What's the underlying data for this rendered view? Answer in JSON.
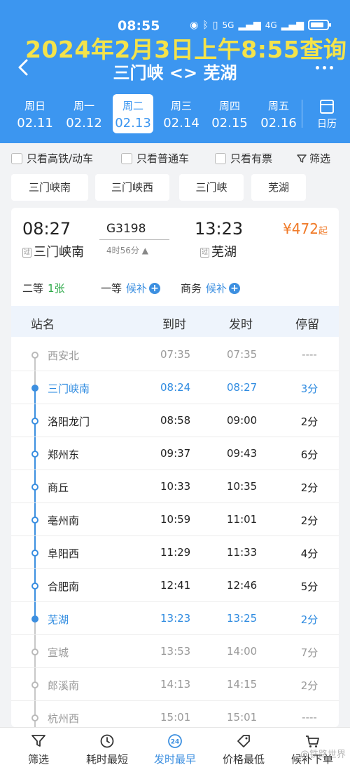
{
  "status": {
    "time": "08:55",
    "net1": "5G",
    "net2": "4G"
  },
  "overlay_text": "2024年2月3日上午8:55查询",
  "header": {
    "route_title": "三门峡 <> 芜湖"
  },
  "dates": [
    {
      "weekday": "周日",
      "date": "02.11"
    },
    {
      "weekday": "周一",
      "date": "02.12"
    },
    {
      "weekday": "周二",
      "date": "02.13"
    },
    {
      "weekday": "周三",
      "date": "02.14"
    },
    {
      "weekday": "周四",
      "date": "02.15"
    },
    {
      "weekday": "周五",
      "date": "02.16"
    }
  ],
  "calendar_label": "日历",
  "filters": {
    "high_speed": "只看高铁/动车",
    "regular": "只看普通车",
    "available": "只看有票",
    "filter_btn": "筛选"
  },
  "station_chips": [
    "三门峡南",
    "三门峡西",
    "三门峡",
    "芜湖"
  ],
  "train": {
    "dep_time": "08:27",
    "arr_time": "13:23",
    "number": "G3198",
    "duration": "4时56分 ▲",
    "price": "¥472",
    "price_suffix": "起",
    "pass_tag": "过",
    "dep_station": "三门峡南",
    "arr_station": "芜湖"
  },
  "seats": {
    "second": {
      "label": "二等",
      "count": "1张"
    },
    "first": {
      "label": "一等",
      "status": "候补"
    },
    "business": {
      "label": "商务",
      "status": "候补"
    }
  },
  "table": {
    "headers": {
      "station": "站名",
      "arrive": "到时",
      "depart": "发时",
      "stop": "停留"
    },
    "rows": [
      {
        "station": "西安北",
        "arrive": "07:35",
        "depart": "07:35",
        "stop": "----"
      },
      {
        "station": "三门峡南",
        "arrive": "08:24",
        "depart": "08:27",
        "stop": "3分"
      },
      {
        "station": "洛阳龙门",
        "arrive": "08:58",
        "depart": "09:00",
        "stop": "2分"
      },
      {
        "station": "郑州东",
        "arrive": "09:37",
        "depart": "09:43",
        "stop": "6分"
      },
      {
        "station": "商丘",
        "arrive": "10:33",
        "depart": "10:35",
        "stop": "2分"
      },
      {
        "station": "亳州南",
        "arrive": "10:59",
        "depart": "11:01",
        "stop": "2分"
      },
      {
        "station": "阜阳西",
        "arrive": "11:29",
        "depart": "11:33",
        "stop": "4分"
      },
      {
        "station": "合肥南",
        "arrive": "12:41",
        "depart": "12:46",
        "stop": "5分"
      },
      {
        "station": "芜湖",
        "arrive": "13:23",
        "depart": "13:25",
        "stop": "2分"
      },
      {
        "station": "宣城",
        "arrive": "13:53",
        "depart": "14:00",
        "stop": "7分"
      },
      {
        "station": "郎溪南",
        "arrive": "14:13",
        "depart": "14:15",
        "stop": "2分"
      },
      {
        "station": "杭州西",
        "arrive": "15:01",
        "depart": "15:01",
        "stop": "----"
      }
    ]
  },
  "bottom_nav": {
    "filter": "筛选",
    "shortest": "耗时最短",
    "earliest": "发时最早",
    "earliest_badge": "24",
    "cheapest": "价格最低",
    "waitlist": "候补下单"
  },
  "watermark": "@铁路世界"
}
